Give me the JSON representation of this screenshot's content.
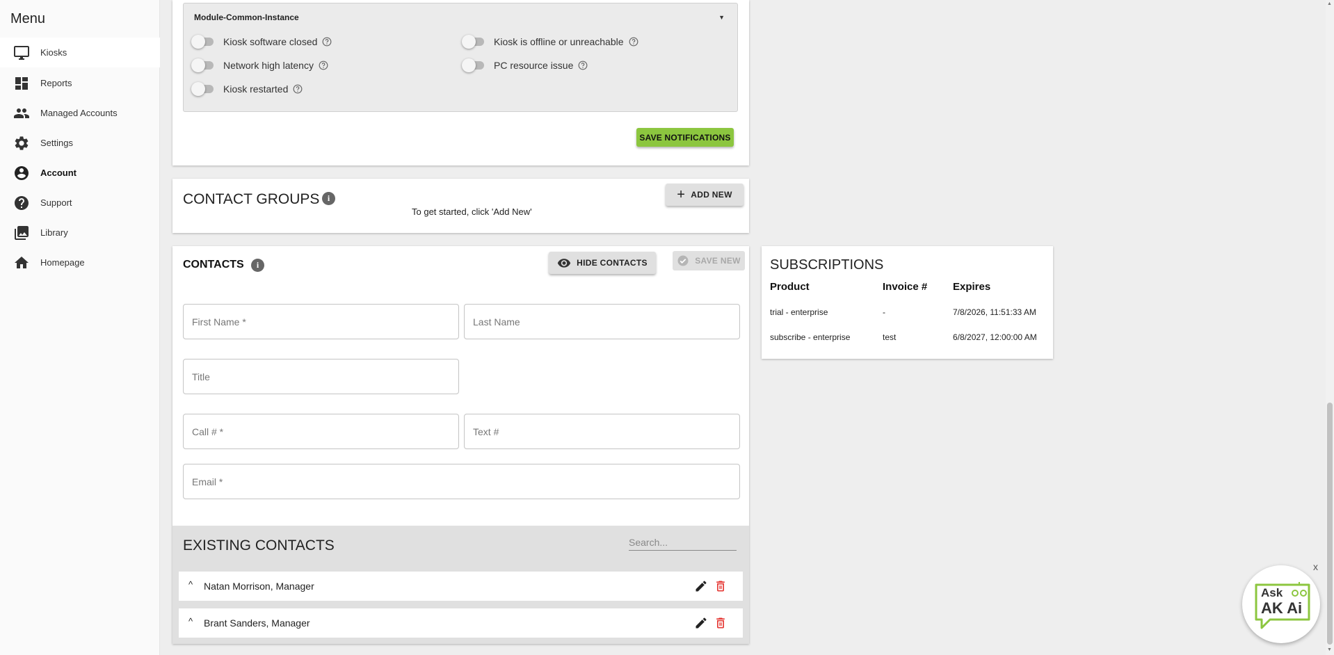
{
  "sidebar": {
    "title": "Menu",
    "items": [
      {
        "label": "Kiosks",
        "icon": "monitor-icon"
      },
      {
        "label": "Reports",
        "icon": "dashboard-icon"
      },
      {
        "label": "Managed Accounts",
        "icon": "people-icon"
      },
      {
        "label": "Settings",
        "icon": "gear-icon"
      },
      {
        "label": "Account",
        "icon": "account-circle-icon"
      },
      {
        "label": "Support",
        "icon": "help-circle-icon"
      },
      {
        "label": "Library",
        "icon": "photo-library-icon"
      },
      {
        "label": "Homepage",
        "icon": "home-icon"
      }
    ],
    "active": "Account"
  },
  "notifications": {
    "module_title": "Module-Common-Instance",
    "toggles": [
      {
        "label": "Kiosk software closed",
        "on": false
      },
      {
        "label": "Kiosk is offline or unreachable",
        "on": false
      },
      {
        "label": "Network high latency",
        "on": false
      },
      {
        "label": "PC resource issue",
        "on": false
      },
      {
        "label": "Kiosk restarted",
        "on": false
      }
    ],
    "save_label": "SAVE NOTIFICATIONS"
  },
  "contact_groups": {
    "title": "CONTACT GROUPS",
    "add_label": "ADD NEW",
    "hint": "To get started, click 'Add New'"
  },
  "contacts": {
    "title": "CONTACTS",
    "hide_label": "HIDE CONTACTS",
    "save_label": "SAVE NEW",
    "fields": {
      "first_name": "First Name *",
      "last_name": "Last Name",
      "title": "Title",
      "call": "Call # *",
      "text": "Text #",
      "email": "Email *"
    },
    "existing": {
      "title": "EXISTING CONTACTS",
      "search_placeholder": "Search...",
      "rows": [
        {
          "name": "Natan Morrison, Manager"
        },
        {
          "name": "Brant Sanders, Manager"
        }
      ]
    }
  },
  "subscriptions": {
    "title": "SUBSCRIPTIONS",
    "headers": [
      "Product",
      "Invoice #",
      "Expires"
    ],
    "rows": [
      {
        "product": "trial - enterprise",
        "invoice": "-",
        "expires": "7/8/2026, 11:51:33 AM"
      },
      {
        "product": "subscribe - enterprise",
        "invoice": "test",
        "expires": "6/8/2027, 12:00:00 AM"
      }
    ]
  },
  "assistant": {
    "line1": "Ask",
    "line2": "AK Ai",
    "close": "x"
  },
  "colors": {
    "accent_green": "#8cc63f",
    "delete_red": "#e53935"
  }
}
